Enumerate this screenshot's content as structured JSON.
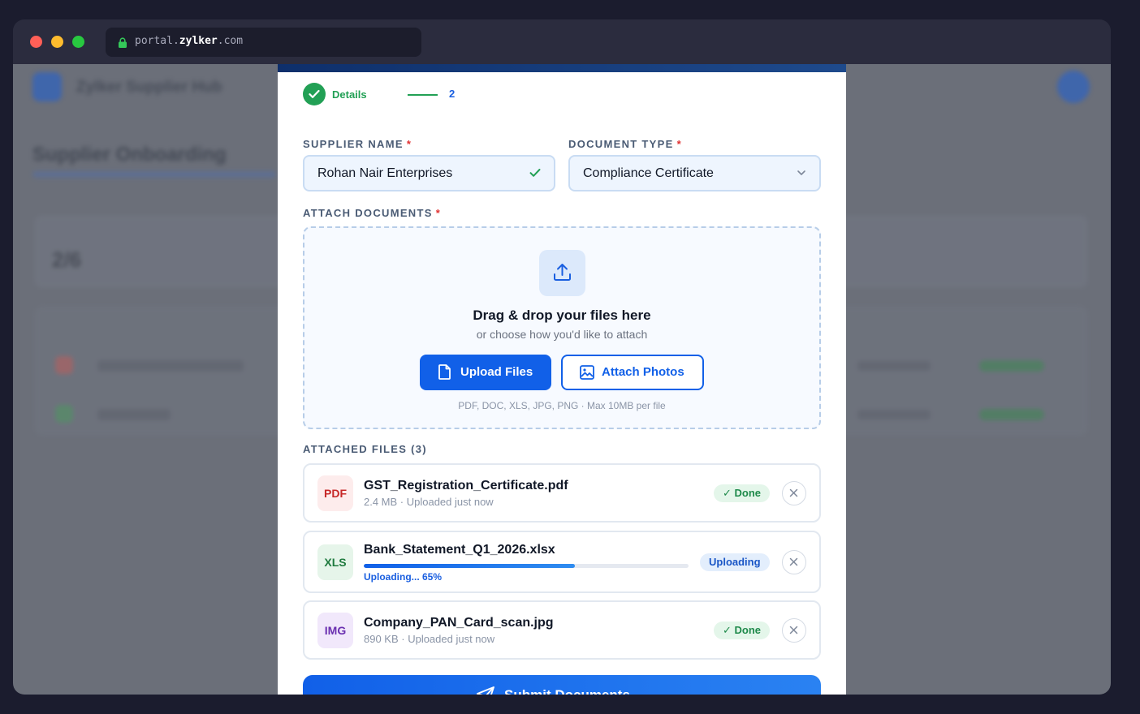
{
  "browser": {
    "url_prefix": "portal.",
    "url_domain": "zylker",
    "url_suffix": ".com"
  },
  "background": {
    "brand": "Zylker Supplier Hub",
    "heading": "Supplier Onboarding",
    "stat": "2/6"
  },
  "stepper": {
    "step1_label": "Details",
    "step2_number": "2"
  },
  "form": {
    "supplier_label": "SUPPLIER NAME",
    "supplier_value": "Rohan Nair Enterprises",
    "doctype_label": "DOCUMENT TYPE",
    "doctype_value": "Compliance Certificate",
    "attach_label": "ATTACH DOCUMENTS",
    "required_mark": "*"
  },
  "dropzone": {
    "title": "Drag & drop your files here",
    "subtitle": "or choose how you'd like to attach",
    "upload_button": "Upload Files",
    "photos_button": "Attach Photos",
    "hint": "PDF, DOC, XLS, JPG, PNG · Max 10MB per file"
  },
  "attached": {
    "heading": "ATTACHED FILES (3)",
    "files": [
      {
        "type": "PDF",
        "name": "GST_Registration_Certificate.pdf",
        "meta": "2.4 MB · Uploaded just now",
        "status": "✓ Done"
      },
      {
        "type": "XLS",
        "name": "Bank_Statement_Q1_2026.xlsx",
        "progress_text": "Uploading... 65%",
        "progress": 0.65,
        "status": "Uploading"
      },
      {
        "type": "IMG",
        "name": "Company_PAN_Card_scan.jpg",
        "meta": "890 KB · Uploaded just now",
        "status": "✓ Done"
      }
    ]
  },
  "submit_label": "Submit Documents",
  "colors": {
    "primary": "#1160e8",
    "success": "#22a055",
    "pdf": "#c62828",
    "xls": "#1f7a3e",
    "img": "#6a2fb0"
  }
}
